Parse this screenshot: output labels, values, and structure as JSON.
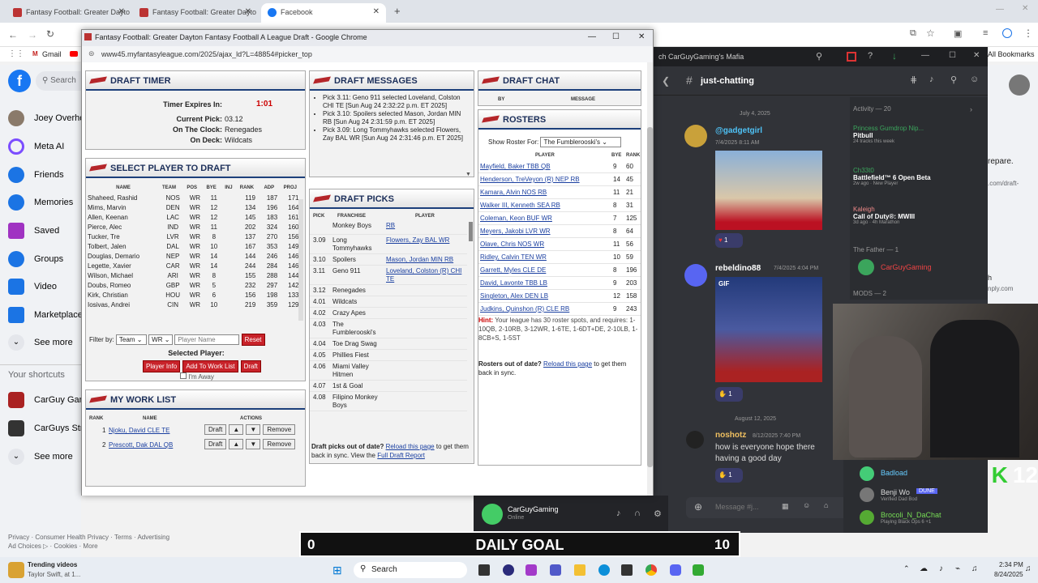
{
  "tabs": [
    {
      "title": "Fantasy Football: Greater Dayto"
    },
    {
      "title": "Fantasy Football: Greater Dayto"
    },
    {
      "title": "Facebook"
    }
  ],
  "bookmarks": {
    "gmail": "Gmail",
    "all": "All Bookmarks"
  },
  "facebook": {
    "search": "Search",
    "items": [
      "Joey Overho",
      "Meta AI",
      "Friends",
      "Memories",
      "Saved",
      "Groups",
      "Video",
      "Marketplace",
      "See more"
    ],
    "shortcuts_title": "Your shortcuts",
    "shortcuts": [
      "CarGuy Gam",
      "CarGuys Stre",
      "See more"
    ],
    "footer1": "Privacy · Consumer Health Privacy · Terms · Advertising",
    "footer2": "Ad Choices ▷ · Cookies · More"
  },
  "draft": {
    "window_title": "Fantasy Football: Greater Dayton Fantasy Football A League Draft - Google Chrome",
    "url": "www45.myfantasyleague.com/2025/ajax_ld?L=48854#picker_top",
    "timer": {
      "title": "DRAFT TIMER",
      "expires_label": "Timer Expires In:",
      "expires_value": "1:01",
      "current_label": "Current Pick:",
      "current_value": "03.12",
      "clock_label": "On The Clock:",
      "clock_value": "Renegades",
      "deck_label": "On Deck:",
      "deck_value": "Wildcats"
    },
    "select": {
      "title": "SELECT PLAYER TO DRAFT",
      "headers": [
        "NAME",
        "TEAM",
        "POS",
        "BYE",
        "INJ",
        "RANK",
        "ADP",
        "PROJ"
      ],
      "rows": [
        [
          "Shaheed, Rashid",
          "NOS",
          "WR",
          "11",
          "",
          "119",
          "187",
          "171"
        ],
        [
          "Mims, Marvin",
          "DEN",
          "WR",
          "12",
          "",
          "134",
          "196",
          "164"
        ],
        [
          "Allen, Keenan",
          "LAC",
          "WR",
          "12",
          "",
          "145",
          "183",
          "161"
        ],
        [
          "Pierce, Alec",
          "IND",
          "WR",
          "11",
          "",
          "202",
          "324",
          "160"
        ],
        [
          "Tucker, Tre",
          "LVR",
          "WR",
          "8",
          "",
          "137",
          "270",
          "156"
        ],
        [
          "Tolbert, Jalen",
          "DAL",
          "WR",
          "10",
          "",
          "167",
          "353",
          "149"
        ],
        [
          "Douglas, Demario",
          "NEP",
          "WR",
          "14",
          "",
          "144",
          "246",
          "146"
        ],
        [
          "Legette, Xavier",
          "CAR",
          "WR",
          "14",
          "",
          "244",
          "284",
          "146"
        ],
        [
          "Wilson, Michael",
          "ARI",
          "WR",
          "8",
          "",
          "155",
          "288",
          "144"
        ],
        [
          "Doubs, Romeo",
          "GBP",
          "WR",
          "5",
          "",
          "232",
          "297",
          "142"
        ],
        [
          "Kirk, Christian",
          "HOU",
          "WR",
          "6",
          "",
          "156",
          "198",
          "133"
        ],
        [
          "Iosivas, Andrei",
          "CIN",
          "WR",
          "10",
          "",
          "219",
          "359",
          "129"
        ]
      ],
      "filter_label": "Filter by:",
      "filter_team": "Team",
      "filter_pos": "WR",
      "filter_name": "Player Name",
      "reset": "Reset",
      "selected_label": "Selected Player:",
      "player_info": "Player Info",
      "add_work": "Add To Work List",
      "draft": "Draft",
      "away": "I'm Away"
    },
    "worklist": {
      "title": "MY WORK LIST",
      "headers": [
        "RANK",
        "NAME",
        "ACTIONS"
      ],
      "rows": [
        [
          "1",
          "Njoku, David CLE TE"
        ],
        [
          "2",
          "Prescott, Dak DAL QB"
        ]
      ],
      "draft": "Draft",
      "up": "▲",
      "down": "▼",
      "remove": "Remove"
    },
    "messages": {
      "title": "DRAFT MESSAGES",
      "items": [
        "Pick 3.11: Geno 911 selected Loveland, Colston CHI TE [Sun Aug 24 2:32:22 p.m. ET 2025]",
        "Pick 3.10: Spoilers selected Mason, Jordan MIN RB [Sun Aug 24 2:31:59 p.m. ET 2025]",
        "Pick 3.09: Long Tommyhawks selected Flowers, Zay BAL WR [Sun Aug 24 2:31:46 p.m. ET 2025]"
      ]
    },
    "picks": {
      "title": "DRAFT PICKS",
      "headers": [
        "PICK",
        "FRANCHISE",
        "PLAYER"
      ],
      "rows": [
        [
          "",
          "Monkey Boys",
          "RB"
        ],
        [
          "3.09",
          "Long Tommyhawks",
          "Flowers, Zay BAL WR"
        ],
        [
          "3.10",
          "Spoilers",
          "Mason, Jordan MIN RB"
        ],
        [
          "3.11",
          "Geno 911",
          "Loveland, Colston (R) CHI TE"
        ],
        [
          "3.12",
          "Renegades",
          ""
        ],
        [
          "4.01",
          "Wildcats",
          ""
        ],
        [
          "4.02",
          "Crazy Apes",
          ""
        ],
        [
          "4.03",
          "The Fumblerooski's",
          ""
        ],
        [
          "4.04",
          "Toe Drag Swag",
          ""
        ],
        [
          "4.05",
          "Phillies Fiest",
          ""
        ],
        [
          "4.06",
          "Miami Valley Hitmen",
          ""
        ],
        [
          "4.07",
          "1st & Goal",
          ""
        ],
        [
          "4.08",
          "Filipino Monkey Boys",
          ""
        ]
      ],
      "footer_a": "Draft picks out of date?",
      "footer_link": "Reload this page",
      "footer_b": "to get them back in sync. View the",
      "footer_link2": "Full Draft Report"
    },
    "chat": {
      "title": "DRAFT CHAT",
      "by": "BY",
      "message": "MESSAGE"
    },
    "rosters": {
      "title": "ROSTERS",
      "show_label": "Show Roster For:",
      "show_value": "The Fumblerooski's",
      "headers": [
        "PLAYER",
        "BYE",
        "RANK"
      ],
      "rows": [
        [
          "Mayfield, Baker TBB QB",
          "9",
          "60"
        ],
        [
          "Henderson, TreVeyon (R) NEP RB",
          "14",
          "45"
        ],
        [
          "Kamara, Alvin NOS RB",
          "11",
          "21"
        ],
        [
          "Walker III, Kenneth SEA RB",
          "8",
          "31"
        ],
        [
          "Coleman, Keon BUF WR",
          "7",
          "125"
        ],
        [
          "Meyers, Jakobi LVR WR",
          "8",
          "64"
        ],
        [
          "Olave, Chris NOS WR",
          "11",
          "56"
        ],
        [
          "Ridley, Calvin TEN WR",
          "10",
          "59"
        ],
        [
          "Garrett, Myles CLE DE",
          "8",
          "196"
        ],
        [
          "David, Lavonte TBB LB",
          "9",
          "203"
        ],
        [
          "Singleton, Alex DEN LB",
          "12",
          "158"
        ],
        [
          "Judkins, Quinshon (R) CLE RB",
          "9",
          "243"
        ]
      ],
      "hint_label": "Hint:",
      "hint": "Your league has 30 roster spots, and requires: 1-10QB, 2-10RB, 3-12WR, 1-6TE, 1-6DT+DE, 2-10LB, 1-8CB+S, 1-5ST",
      "ood": "Rosters out of date?",
      "ood_link": "Reload this page",
      "ood_b": "to get them back in sync."
    }
  },
  "discord": {
    "server": "ch CarGuyGaming's Mafia",
    "channel": "just-chatting",
    "date1": "July 4, 2025",
    "msg1_user": "@gadgetgirl",
    "msg1_time": "7/4/2025 8:11 AM",
    "react1": "1",
    "msg2_user": "rebeldino88",
    "msg2_time": "7/4/2025 4:04 PM",
    "gif": "GIF",
    "react2": "1",
    "date2": "August 12, 2025",
    "msg3_user": "noshotz",
    "msg3_time": "8/12/2025 7:40 PM",
    "msg3_text": "how is everyone hope there having a good day",
    "react3": "1",
    "input": "Message #j...",
    "me": "CarGuyGaming",
    "me_status": "Online",
    "activity": "Activity — 20",
    "acts": [
      [
        "Princess Gumdrop Nip...",
        "Pitbull",
        "24 tracks this week"
      ],
      [
        "Ch33t0",
        "Battlefield™ 6 Open Beta",
        "2w ago · New Player"
      ],
      [
        "Kaleigh",
        "Call of Duty®: MWIII",
        "3d ago · 4h Marathon"
      ]
    ],
    "father": "The Father — 1",
    "father_user": "CarGuyGaming",
    "mods": "MODS — 2",
    "bottom_users": [
      "Badload",
      "Benji Wo",
      "Brocoli_N_DaChat"
    ],
    "bottom_tag": "DUNE",
    "bottom_sub1": "Verified Dad Bod",
    "bottom_sub2": "Playing Black Ops 6 +1"
  },
  "stream": {
    "counter": "12",
    "goal_left": "0",
    "goal_label": "DAILY GOAL",
    "goal_right": "10"
  },
  "taskbar": {
    "search": "Search",
    "news_title": "Trending videos",
    "news_sub": "Taylor Swift, at 1...",
    "time": "2:34 PM",
    "date": "8/24/2025"
  },
  "fb_side": {
    "prepare": "repare.",
    "url": ".com/draft-",
    "link": "nply.com",
    "h": "h"
  }
}
